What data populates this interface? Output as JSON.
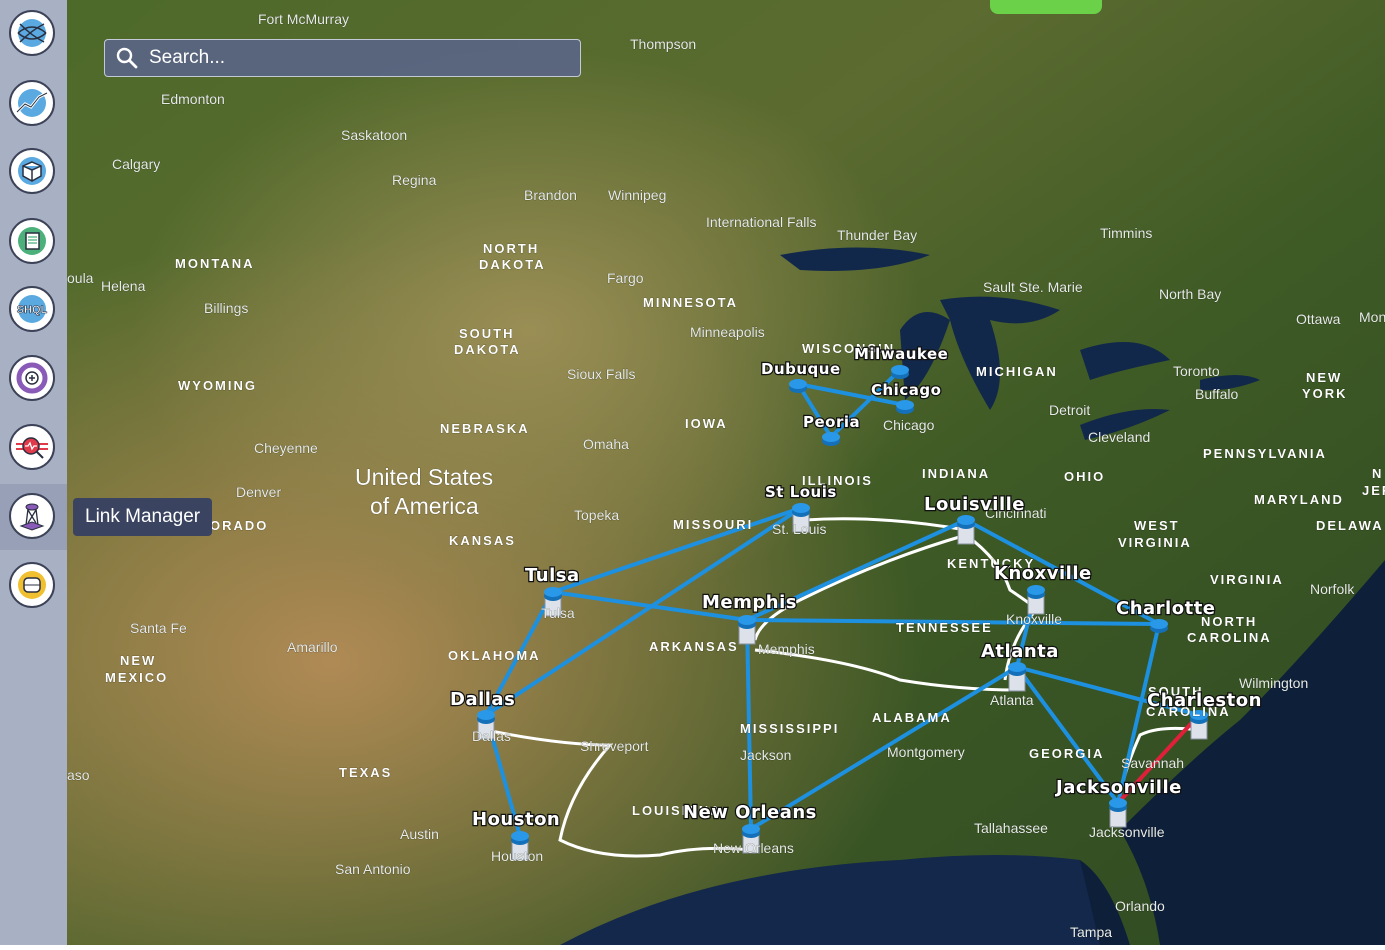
{
  "sidebar": {
    "items": [
      {
        "name": "globe",
        "icon": "globe-icon",
        "color": "#5aa9e0"
      },
      {
        "name": "analytics",
        "icon": "chart-line-icon",
        "color": "#5aa9e0"
      },
      {
        "name": "3d-model",
        "icon": "cube-icon",
        "color": "#5aa9e0"
      },
      {
        "name": "documents",
        "icon": "document-icon",
        "color": "#4cb07a"
      },
      {
        "name": "shql",
        "icon": "shql-icon",
        "label": "SHQL",
        "color": "#5aa9e0"
      },
      {
        "name": "add-layer",
        "icon": "add-circle-icon",
        "color": "#8a5ab8"
      },
      {
        "name": "signal-search",
        "icon": "signal-search-icon",
        "color": "#e0394a"
      },
      {
        "name": "link-manager",
        "icon": "tower-icon",
        "color": "#8a5ab8",
        "active": true
      },
      {
        "name": "network",
        "icon": "network-icon",
        "color": "#f0c030"
      }
    ]
  },
  "tooltip": "Link Manager",
  "search": {
    "placeholder": "Search...",
    "value": ""
  },
  "colors": {
    "link": "#1e90e0",
    "broken_link": "#e0203a",
    "route": "#ffffff",
    "ocean": "#0e1f3a"
  },
  "map_labels": [
    {
      "text": "Fort McMurray",
      "kind": "city"
    },
    {
      "text": "Thompson",
      "kind": "city"
    },
    {
      "text": "Edmonton",
      "kind": "city"
    },
    {
      "text": "Saskatoon",
      "kind": "city"
    },
    {
      "text": "Calgary",
      "kind": "city"
    },
    {
      "text": "Regina",
      "kind": "city"
    },
    {
      "text": "Brandon",
      "kind": "city"
    },
    {
      "text": "Winnipeg",
      "kind": "city"
    },
    {
      "text": "International Falls",
      "kind": "city"
    },
    {
      "text": "Thunder Bay",
      "kind": "city"
    },
    {
      "text": "Timmins",
      "kind": "city"
    },
    {
      "text": "MONTANA",
      "kind": "state"
    },
    {
      "text": "Helena",
      "kind": "city"
    },
    {
      "text": "oula",
      "kind": "city"
    },
    {
      "text": "Billings",
      "kind": "city"
    },
    {
      "text": "NORTH",
      "kind": "state"
    },
    {
      "text": "DAKOTA",
      "kind": "state"
    },
    {
      "text": "Fargo",
      "kind": "city"
    },
    {
      "text": "MINNESOTA",
      "kind": "state"
    },
    {
      "text": "Sault Ste. Marie",
      "kind": "city"
    },
    {
      "text": "North Bay",
      "kind": "city"
    },
    {
      "text": "Ottawa",
      "kind": "city"
    },
    {
      "text": "Mon",
      "kind": "city"
    },
    {
      "text": "SOUTH",
      "kind": "state"
    },
    {
      "text": "DAKOTA",
      "kind": "state"
    },
    {
      "text": "Minneapolis",
      "kind": "city"
    },
    {
      "text": "WYOMING",
      "kind": "state"
    },
    {
      "text": "Sioux Falls",
      "kind": "city"
    },
    {
      "text": "WISCONSIN",
      "kind": "state"
    },
    {
      "text": "MICHIGAN",
      "kind": "state"
    },
    {
      "text": "Toronto",
      "kind": "city"
    },
    {
      "text": "NEW",
      "kind": "state"
    },
    {
      "text": "YORK",
      "kind": "state"
    },
    {
      "text": "Buffalo",
      "kind": "city"
    },
    {
      "text": "NEBRASKA",
      "kind": "state"
    },
    {
      "text": "IOWA",
      "kind": "state"
    },
    {
      "text": "Chicago",
      "kind": "city"
    },
    {
      "text": "Detroit",
      "kind": "city"
    },
    {
      "text": "Cleveland",
      "kind": "city"
    },
    {
      "text": "Cheyenne",
      "kind": "city"
    },
    {
      "text": "Omaha",
      "kind": "city"
    },
    {
      "text": "PENNSYLVANIA",
      "kind": "state"
    },
    {
      "text": "United States",
      "kind": "country"
    },
    {
      "text": "of America",
      "kind": "country"
    },
    {
      "text": "INDIANA",
      "kind": "state"
    },
    {
      "text": "OHIO",
      "kind": "state"
    },
    {
      "text": "Denver",
      "kind": "city"
    },
    {
      "text": "ILLINOIS",
      "kind": "state"
    },
    {
      "text": "N",
      "kind": "state"
    },
    {
      "text": "JER",
      "kind": "state"
    },
    {
      "text": "MARYLAND",
      "kind": "state"
    },
    {
      "text": "ORADO",
      "kind": "state"
    },
    {
      "text": "Topeka",
      "kind": "city"
    },
    {
      "text": "Cincinnati",
      "kind": "city"
    },
    {
      "text": "MISSOURI",
      "kind": "state"
    },
    {
      "text": "St. Louis",
      "kind": "city"
    },
    {
      "text": "DELAWA",
      "kind": "state"
    },
    {
      "text": "KANSAS",
      "kind": "state"
    },
    {
      "text": "WEST",
      "kind": "state"
    },
    {
      "text": "VIRGINIA",
      "kind": "state"
    },
    {
      "text": "KENTUCKY",
      "kind": "state"
    },
    {
      "text": "VIRGINIA",
      "kind": "state"
    },
    {
      "text": "Norfolk",
      "kind": "city"
    },
    {
      "text": "Tulsa",
      "kind": "city"
    },
    {
      "text": "NORTH",
      "kind": "state"
    },
    {
      "text": "CAROLINA",
      "kind": "state"
    },
    {
      "text": "Santa Fe",
      "kind": "city"
    },
    {
      "text": "Knoxville",
      "kind": "city"
    },
    {
      "text": "TENNESSEE",
      "kind": "state"
    },
    {
      "text": "Amarillo",
      "kind": "city"
    },
    {
      "text": "ARKANSAS",
      "kind": "state"
    },
    {
      "text": "Memphis",
      "kind": "city"
    },
    {
      "text": "NEW",
      "kind": "state"
    },
    {
      "text": "MEXICO",
      "kind": "state"
    },
    {
      "text": "OKLAHOMA",
      "kind": "state"
    },
    {
      "text": "Wilmington",
      "kind": "city"
    },
    {
      "text": "Atlanta",
      "kind": "city"
    },
    {
      "text": "SOUTH",
      "kind": "state"
    },
    {
      "text": "CAROLINA",
      "kind": "state"
    },
    {
      "text": "Dallas",
      "kind": "city"
    },
    {
      "text": "ALABAMA",
      "kind": "state"
    },
    {
      "text": "MISSISSIPPI",
      "kind": "state"
    },
    {
      "text": "Shreveport",
      "kind": "city"
    },
    {
      "text": "Jackson",
      "kind": "city"
    },
    {
      "text": "Montgomery",
      "kind": "city"
    },
    {
      "text": "GEORGIA",
      "kind": "state"
    },
    {
      "text": "Savannah",
      "kind": "city"
    },
    {
      "text": "aso",
      "kind": "city"
    },
    {
      "text": "TEXAS",
      "kind": "state"
    },
    {
      "text": "LOUISIANA",
      "kind": "state"
    },
    {
      "text": "Tallahassee",
      "kind": "city"
    },
    {
      "text": "Jacksonville",
      "kind": "city"
    },
    {
      "text": "Austin",
      "kind": "city"
    },
    {
      "text": "New Orleans",
      "kind": "city"
    },
    {
      "text": "Houston",
      "kind": "city"
    },
    {
      "text": "San Antonio",
      "kind": "city"
    },
    {
      "text": "Orlando",
      "kind": "city"
    },
    {
      "text": "Tampa",
      "kind": "city"
    }
  ],
  "nodes": [
    "Dubuque",
    "Milwaukee",
    "Chicago",
    "Peoria",
    "St Louis",
    "Louisville",
    "Knoxville",
    "Charlotte",
    "Memphis",
    "Atlanta",
    "Charleston",
    "Jacksonville",
    "New Orleans",
    "Houston",
    "Dallas",
    "Tulsa"
  ],
  "links": [
    {
      "from": "Dubuque",
      "to": "Chicago",
      "status": "up"
    },
    {
      "from": "Dubuque",
      "to": "Peoria",
      "status": "up"
    },
    {
      "from": "Peoria",
      "to": "Milwaukee",
      "status": "up"
    },
    {
      "from": "Tulsa",
      "to": "St Louis",
      "status": "up"
    },
    {
      "from": "Dallas",
      "to": "St Louis",
      "status": "up"
    },
    {
      "from": "Dallas",
      "to": "Tulsa",
      "status": "up"
    },
    {
      "from": "Tulsa",
      "to": "Memphis",
      "status": "up"
    },
    {
      "from": "Memphis",
      "to": "Louisville",
      "status": "up"
    },
    {
      "from": "Memphis",
      "to": "Charlotte",
      "status": "up"
    },
    {
      "from": "Memphis",
      "to": "New Orleans",
      "status": "up"
    },
    {
      "from": "Louisville",
      "to": "Charlotte",
      "status": "up"
    },
    {
      "from": "Knoxville",
      "to": "Atlanta",
      "status": "up"
    },
    {
      "from": "Atlanta",
      "to": "Charleston",
      "status": "up"
    },
    {
      "from": "Atlanta",
      "to": "Jacksonville",
      "status": "up"
    },
    {
      "from": "Atlanta",
      "to": "New Orleans",
      "status": "up"
    },
    {
      "from": "Charlotte",
      "to": "Jacksonville",
      "status": "up"
    },
    {
      "from": "Dallas",
      "to": "Houston",
      "status": "up"
    },
    {
      "from": "Jacksonville",
      "to": "Charleston",
      "status": "down"
    }
  ]
}
